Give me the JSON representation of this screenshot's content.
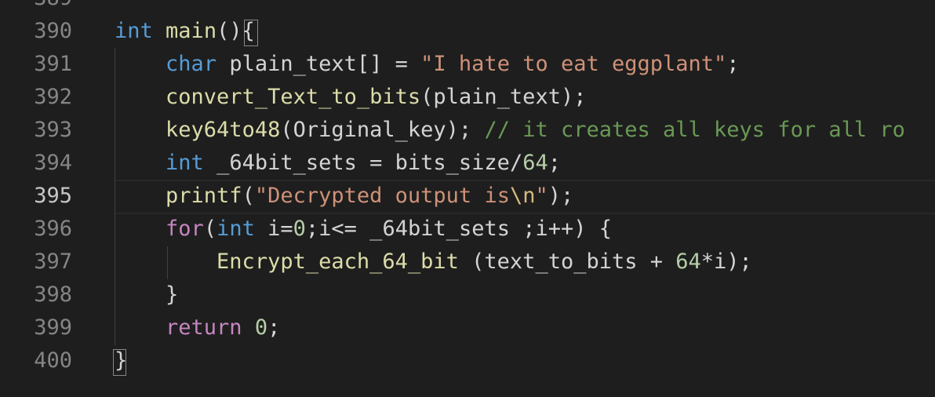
{
  "editor": {
    "theme": {
      "background": "#1e1e1e",
      "keyword": "#569cd6",
      "control": "#c586c0",
      "function": "#dcdcaa",
      "string": "#ce9178",
      "escape": "#d7ba7d",
      "number": "#b5cea8",
      "comment": "#6a9955",
      "line_number": "#858585"
    },
    "partial_top_line_number": "389",
    "active_line": "395",
    "lines": [
      {
        "number": "390",
        "tokens": [
          {
            "t": "int",
            "c": "kw"
          },
          {
            "t": " ",
            "c": "var"
          },
          {
            "t": "main",
            "c": "fn"
          },
          {
            "t": "()",
            "c": "punc"
          },
          {
            "t": "{",
            "c": "punc"
          }
        ]
      },
      {
        "number": "391",
        "tokens": [
          {
            "t": "    ",
            "c": "var"
          },
          {
            "t": "char",
            "c": "kw"
          },
          {
            "t": " plain_text[] = ",
            "c": "var"
          },
          {
            "t": "\"I hate to eat eggplant\"",
            "c": "str"
          },
          {
            "t": ";",
            "c": "punc"
          }
        ]
      },
      {
        "number": "392",
        "tokens": [
          {
            "t": "    ",
            "c": "var"
          },
          {
            "t": "convert_Text_to_bits",
            "c": "fn"
          },
          {
            "t": "(plain_text);",
            "c": "var"
          }
        ]
      },
      {
        "number": "393",
        "tokens": [
          {
            "t": "    ",
            "c": "var"
          },
          {
            "t": "key64to48",
            "c": "fn"
          },
          {
            "t": "(Original_key); ",
            "c": "var"
          },
          {
            "t": "// it creates all keys for all ro",
            "c": "com"
          }
        ]
      },
      {
        "number": "394",
        "tokens": [
          {
            "t": "    ",
            "c": "var"
          },
          {
            "t": "int",
            "c": "kw"
          },
          {
            "t": " _64bit_sets = bits_size/",
            "c": "var"
          },
          {
            "t": "64",
            "c": "num"
          },
          {
            "t": ";",
            "c": "punc"
          }
        ]
      },
      {
        "number": "395",
        "tokens": [
          {
            "t": "    ",
            "c": "var"
          },
          {
            "t": "printf",
            "c": "fn"
          },
          {
            "t": "(",
            "c": "punc"
          },
          {
            "t": "\"Decrypted output is",
            "c": "str"
          },
          {
            "t": "\\n",
            "c": "esc"
          },
          {
            "t": "\"",
            "c": "str"
          },
          {
            "t": ");",
            "c": "punc"
          }
        ]
      },
      {
        "number": "396",
        "tokens": [
          {
            "t": "    ",
            "c": "var"
          },
          {
            "t": "for",
            "c": "ctrl"
          },
          {
            "t": "(",
            "c": "punc"
          },
          {
            "t": "int",
            "c": "kw"
          },
          {
            "t": " i=",
            "c": "var"
          },
          {
            "t": "0",
            "c": "num"
          },
          {
            "t": ";i<= _64bit_sets ;i++) {",
            "c": "var"
          }
        ]
      },
      {
        "number": "397",
        "tokens": [
          {
            "t": "        ",
            "c": "var"
          },
          {
            "t": "Encrypt_each_64_bit",
            "c": "fn"
          },
          {
            "t": " (text_to_bits + ",
            "c": "var"
          },
          {
            "t": "64",
            "c": "num"
          },
          {
            "t": "*i);",
            "c": "var"
          }
        ]
      },
      {
        "number": "398",
        "tokens": [
          {
            "t": "    }",
            "c": "var"
          }
        ]
      },
      {
        "number": "399",
        "tokens": [
          {
            "t": "    ",
            "c": "var"
          },
          {
            "t": "return",
            "c": "ctrl"
          },
          {
            "t": " ",
            "c": "var"
          },
          {
            "t": "0",
            "c": "num"
          },
          {
            "t": ";",
            "c": "punc"
          }
        ]
      },
      {
        "number": "400",
        "tokens": [
          {
            "t": "}",
            "c": "punc"
          }
        ]
      }
    ]
  }
}
